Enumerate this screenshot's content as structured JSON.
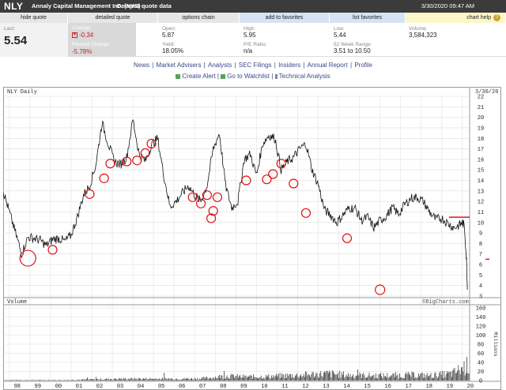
{
  "header": {
    "symbol": "NLY",
    "company": "Annaly Capital Management Inc. (NYS)",
    "delayed": "Delayed quote data",
    "timestamp": "3/30/2020 09:47 AM"
  },
  "tabs": {
    "hide_quote": "hide quote",
    "detailed_quote": "detailed quote",
    "options_chain": "options chain",
    "add_to_favorites": "add to favorites",
    "list_favorites": "list favorites",
    "chart_help": "chart help",
    "help_mark": "?"
  },
  "quote": {
    "last_label": "Last:",
    "last_value": "5.54",
    "change_label": "Change:",
    "change_value": "-0.34",
    "pct_change_label": "Percent Change:",
    "pct_change_value": "-5.78%",
    "open_label": "Open:",
    "open_value": "5.87",
    "yield_label": "Yield:",
    "yield_value": "18.05%",
    "high_label": "High:",
    "high_value": "5.95",
    "pe_label": "P/E Ratio:",
    "pe_value": "n/a",
    "low_label": "Low:",
    "low_value": "5.44",
    "week52_label": "52 Week Range:",
    "week52_value": "3.51 to 10.50",
    "volume_label": "Volume:",
    "volume_value": "3,584,323"
  },
  "links": [
    "News",
    "Market Advisers",
    "Analysts",
    "SEC Filings",
    "Insiders",
    "Annual Report",
    "Profile"
  ],
  "actions": {
    "create_alert": "Create Alert",
    "go_to_watchlist": "Go to Watchlist",
    "technical_analysis": "Technical Analysis"
  },
  "colors": {
    "alert_red": "#cc1f1f",
    "price_line": "#111111",
    "annotation": "#e01010"
  },
  "chart_data": {
    "type": "line",
    "title": "NLY Daily",
    "date_label": "3/30/20",
    "watermark": "©BigCharts.com",
    "volume_label": "Volume",
    "volume_unit": "Millions",
    "x_ticks": [
      "98",
      "99",
      "00",
      "01",
      "02",
      "03",
      "04",
      "05",
      "06",
      "07",
      "08",
      "09",
      "10",
      "11",
      "12",
      "13",
      "14",
      "15",
      "16",
      "17",
      "18",
      "19",
      "20"
    ],
    "y_ticks": [
      3,
      4,
      5,
      6,
      7,
      8,
      9,
      10,
      11,
      12,
      13,
      14,
      15,
      16,
      17,
      18,
      19,
      20,
      21,
      22
    ],
    "ylim": [
      3,
      22
    ],
    "volume_ticks": [
      0,
      20,
      40,
      60,
      80,
      100,
      120,
      140,
      160
    ],
    "volume_ylim": [
      0,
      160
    ],
    "grid": true,
    "series": [
      {
        "x": [
          1997.7,
          1998.0,
          1998.3,
          1998.6,
          1998.9,
          1999.2,
          1999.5,
          1999.8,
          2000.1,
          2000.4,
          2000.7,
          2001.0,
          2001.3,
          2001.6,
          2001.9,
          2002.2,
          2002.5,
          2002.8,
          2003.1,
          2003.4,
          2003.7,
          2004.0,
          2004.3,
          2004.6,
          2004.9,
          2005.2,
          2005.5,
          2005.8,
          2006.1,
          2006.4,
          2006.7,
          2007.0,
          2007.3,
          2007.6,
          2007.9,
          2008.2,
          2008.5,
          2008.8,
          2009.1,
          2009.4,
          2009.7,
          2010.0,
          2010.3,
          2010.6,
          2010.9,
          2011.2,
          2011.5,
          2011.8,
          2012.1,
          2012.4,
          2012.7,
          2013.0,
          2013.3,
          2013.6,
          2013.9,
          2014.2,
          2014.5,
          2014.8,
          2015.1,
          2015.4,
          2015.7,
          2016.0,
          2016.3,
          2016.6,
          2016.9,
          2017.2,
          2017.5,
          2017.8,
          2018.1,
          2018.4,
          2018.7,
          2019.0,
          2019.3,
          2019.6,
          2019.9,
          2020.0,
          2020.1,
          2020.2,
          2020.24
        ],
        "values": [
          13.0,
          11.0,
          9.0,
          7.0,
          8.6,
          8.5,
          8.3,
          7.8,
          8.4,
          8.5,
          8.2,
          8.8,
          10.5,
          12.6,
          13.5,
          15.5,
          19.5,
          17.5,
          15.8,
          15.5,
          16.2,
          19.8,
          16.5,
          15.8,
          17.4,
          18.0,
          14.5,
          11.5,
          12.0,
          12.8,
          13.5,
          12.6,
          12.0,
          13.5,
          17.0,
          18.5,
          13.5,
          11.4,
          12.0,
          16.0,
          16.5,
          14.5,
          17.5,
          18.3,
          18.0,
          15.0,
          15.8,
          16.2,
          17.0,
          17.5,
          15.0,
          13.6,
          11.2,
          10.7,
          10.0,
          10.7,
          11.4,
          11.3,
          10.2,
          10.5,
          9.5,
          10.2,
          10.6,
          11.4,
          10.8,
          11.7,
          12.3,
          12.4,
          12.0,
          11.0,
          10.3,
          10.4,
          9.9,
          9.5,
          9.8,
          10.0,
          9.6,
          6.3,
          3.6
        ]
      }
    ],
    "volume_series": {
      "x": [
        1997.7,
        1998.5,
        1999.5,
        2000.5,
        2001.5,
        2002.5,
        2003.5,
        2004.5,
        2005.5,
        2006.5,
        2007.5,
        2008.5,
        2009.5,
        2010.5,
        2011.5,
        2012.5,
        2013.5,
        2014.5,
        2015.5,
        2016.5,
        2017.5,
        2018.5,
        2019.5,
        2020.2
      ],
      "values": [
        1,
        1,
        1,
        1,
        2,
        3,
        4,
        4,
        4,
        4,
        5,
        10,
        8,
        9,
        11,
        13,
        15,
        12,
        11,
        11,
        12,
        11,
        15,
        32
      ]
    },
    "annotations": {
      "circles": [
        [
          1998.9,
          6.6
        ],
        [
          2000.1,
          7.4
        ],
        [
          2001.9,
          12.7
        ],
        [
          2002.6,
          14.2
        ],
        [
          2002.9,
          15.6
        ],
        [
          2003.7,
          15.8
        ],
        [
          2004.2,
          15.9
        ],
        [
          2004.6,
          16.6
        ],
        [
          2004.9,
          17.5
        ],
        [
          2006.9,
          12.4
        ],
        [
          2007.3,
          11.8
        ],
        [
          2007.6,
          12.6
        ],
        [
          2007.8,
          10.4
        ],
        [
          2007.9,
          11.1
        ],
        [
          2008.1,
          12.4
        ],
        [
          2009.5,
          14.0
        ],
        [
          2010.5,
          14.1
        ],
        [
          2010.8,
          14.6
        ],
        [
          2011.2,
          15.6
        ],
        [
          2011.8,
          13.7
        ],
        [
          2012.4,
          10.9
        ],
        [
          2014.4,
          8.5
        ],
        [
          2016.0,
          3.6
        ]
      ],
      "resistance_level": 10.5,
      "current_marker": 6.5
    }
  }
}
